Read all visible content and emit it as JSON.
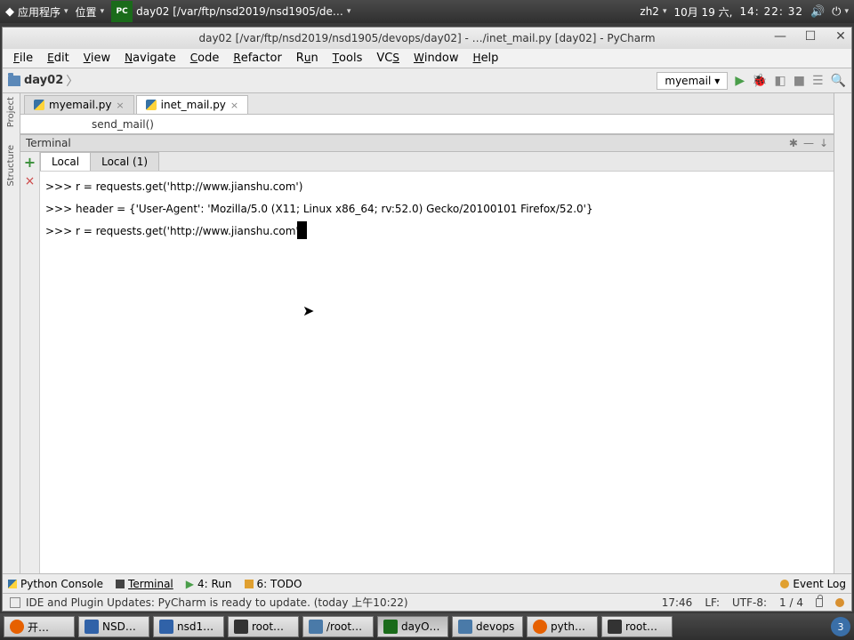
{
  "gnome": {
    "apps_label": "应用程序",
    "places_label": "位置",
    "running_app_title": "day02 [/var/ftp/nsd2019/nsd1905/de…",
    "input_method": "zh2",
    "date": "10月 19 六,",
    "time": "14: 22: 32"
  },
  "pycharm": {
    "window_title": "day02 [/var/ftp/nsd2019/nsd1905/devops/day02] - …/inet_mail.py [day02] - PyCharm",
    "menus": [
      "File",
      "Edit",
      "View",
      "Navigate",
      "Code",
      "Refactor",
      "Run",
      "Tools",
      "VCS",
      "Window",
      "Help"
    ],
    "breadcrumb": "day02",
    "run_config": "myemail",
    "editor_tabs": [
      {
        "label": "myemail.py",
        "active": false
      },
      {
        "label": "inet_mail.py",
        "active": true
      }
    ],
    "editor_visible_line": "send_mail()",
    "terminal": {
      "panel_title": "Terminal",
      "tabs": [
        {
          "label": "Local",
          "active": true
        },
        {
          "label": "Local (1)",
          "active": false
        }
      ],
      "lines": [
        ">>> r = requests.get('http://www.jianshu.com')",
        ">>> header = {'User-Agent': 'Mozilla/5.0 (X11; Linux x86_64; rv:52.0) Gecko/20100101 Firefox/52.0'}",
        ">>> r = requests.get('http://www.jianshu.com'"
      ]
    },
    "tool_buttons": {
      "python_console": "Python Console",
      "terminal": "Terminal",
      "run": "4: Run",
      "todo": "6: TODO",
      "event_log": "Event Log"
    },
    "status_message": "IDE and Plugin Updates: PyCharm is ready to update. (today 上午10:22)",
    "status_right": {
      "time": "17:46",
      "linesep": "LF:",
      "encoding": "UTF-8:",
      "pos": "1 / 4"
    }
  },
  "taskbar": {
    "items": [
      {
        "label": "root…",
        "icon": "term"
      },
      {
        "label": "pyth…",
        "icon": "ff"
      },
      {
        "label": "devops",
        "icon": "file"
      },
      {
        "label": "dayO…",
        "icon": "pc",
        "active": true
      },
      {
        "label": "/root…",
        "icon": "file"
      },
      {
        "label": "root…",
        "icon": "term"
      },
      {
        "label": "nsd1…",
        "icon": "app"
      },
      {
        "label": "NSD…",
        "icon": "app"
      },
      {
        "label": "开…",
        "icon": "ff"
      }
    ],
    "tray": "3"
  }
}
